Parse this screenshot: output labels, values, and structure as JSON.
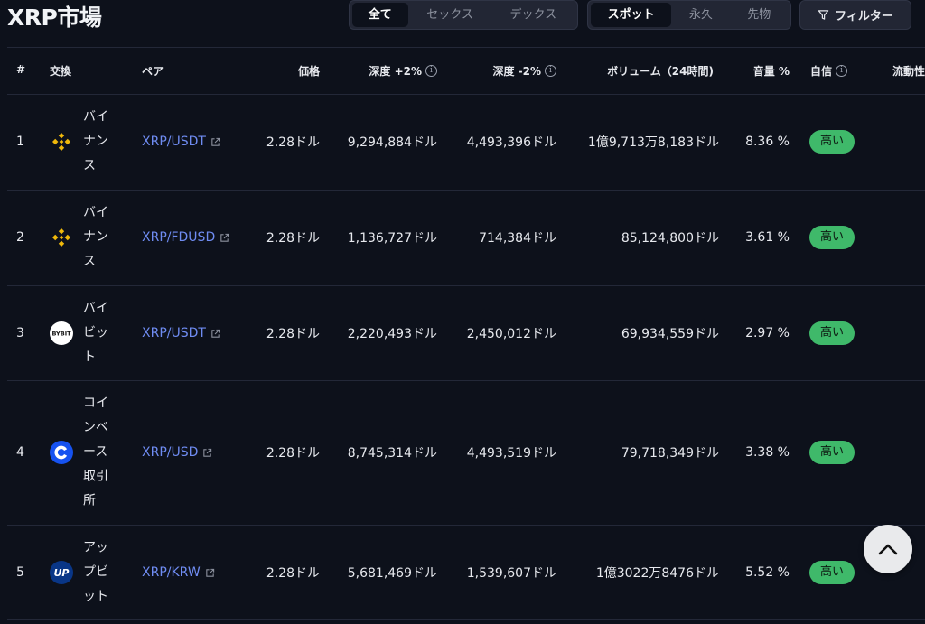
{
  "page_title": "XRP市場",
  "type_tabs": [
    {
      "label": "全て",
      "active": true
    },
    {
      "label": "セックス",
      "active": false
    },
    {
      "label": "デックス",
      "active": false
    }
  ],
  "market_tabs": [
    {
      "label": "スポット",
      "active": true
    },
    {
      "label": "永久",
      "active": false
    },
    {
      "label": "先物",
      "active": false
    }
  ],
  "filter_label": "フィルター",
  "columns": {
    "index": "#",
    "exchange": "交換",
    "pair": "ペア",
    "price": "価格",
    "depth_plus": "深度 +2%",
    "depth_minus": "深度 -2%",
    "volume": "ボリューム（24時間)",
    "volume_pct": "音量 %",
    "confidence": "自信",
    "liquidity": "流動性"
  },
  "rows": [
    {
      "index": "1",
      "exchange": "バイナンス",
      "logo": "binance-logo",
      "pair": "XRP/USDT",
      "price": "2.28ドル",
      "depth_plus": "9,294,884ドル",
      "depth_minus": "4,493,396ドル",
      "volume": "1億9,713万8,183ドル",
      "volume_pct": "8.36 %",
      "confidence": "高い"
    },
    {
      "index": "2",
      "exchange": "バイナンス",
      "logo": "binance-logo",
      "pair": "XRP/FDUSD",
      "price": "2.28ドル",
      "depth_plus": "1,136,727ドル",
      "depth_minus": "714,384ドル",
      "volume": "85,124,800ドル",
      "volume_pct": "3.61 %",
      "confidence": "高い"
    },
    {
      "index": "3",
      "exchange": "バイビット",
      "logo": "bybit-logo",
      "pair": "XRP/USDT",
      "price": "2.28ドル",
      "depth_plus": "2,220,493ドル",
      "depth_minus": "2,450,012ドル",
      "volume": "69,934,559ドル",
      "volume_pct": "2.97 %",
      "confidence": "高い"
    },
    {
      "index": "4",
      "exchange": "コインベース取引所",
      "logo": "coinbase-logo",
      "pair": "XRP/USD",
      "price": "2.28ドル",
      "depth_plus": "8,745,314ドル",
      "depth_minus": "4,493,519ドル",
      "volume": "79,718,349ドル",
      "volume_pct": "3.38 %",
      "confidence": "高い"
    },
    {
      "index": "5",
      "exchange": "アップビット",
      "logo": "upbit-logo",
      "pair": "XRP/KRW",
      "price": "2.28ドル",
      "depth_plus": "5,681,469ドル",
      "depth_minus": "1,539,607ドル",
      "volume": "1億3022万8476ドル",
      "volume_pct": "5.52 %",
      "confidence": "高い"
    }
  ],
  "bybit_logo_text": "BYBIT",
  "upbit_logo_text": "UP",
  "colors": {
    "background": "#0d111b",
    "link": "#6f8cf2",
    "badge_high": "#3fb96a",
    "binance": "#f0b90b",
    "coinbase": "#1652f0",
    "upbit": "#093687"
  }
}
